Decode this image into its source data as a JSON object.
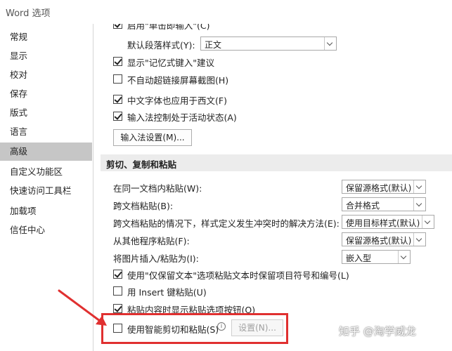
{
  "window": {
    "title": "Word 选项"
  },
  "sidebar": {
    "items": [
      {
        "label": "常规"
      },
      {
        "label": "显示"
      },
      {
        "label": "校对"
      },
      {
        "label": "保存"
      },
      {
        "label": "版式"
      },
      {
        "label": "语言"
      },
      {
        "label": "高级",
        "active": true
      },
      {
        "label": "自定义功能区"
      },
      {
        "label": "快速访问工具栏"
      },
      {
        "label": "加载项"
      },
      {
        "label": "信任中心"
      }
    ]
  },
  "main": {
    "top_cut_label": "启用\"单击即输入\"(C)",
    "default_para_style": {
      "label": "默认段落样式(Y):",
      "value": "正文"
    },
    "options_a": [
      {
        "label": "显示\"记忆式键入\"建议",
        "checked": true
      },
      {
        "label": "不自动超链接屏幕截图(H)",
        "checked": false
      },
      {
        "label": "中文字体也应用于西文(F)",
        "checked": true
      },
      {
        "label": "输入法控制处于活动状态(A)",
        "checked": true
      }
    ],
    "ime_settings_button": "输入法设置(M)...",
    "cut_copy_paste": {
      "section_title": "剪切、复制和粘贴",
      "rows": [
        {
          "label": "在同一文档内粘贴(W):",
          "value": "保留源格式(默认)"
        },
        {
          "label": "跨文档粘贴(B):",
          "value": "合并格式"
        },
        {
          "label": "跨文档粘贴的情况下，样式定义发生冲突时的解决方法(E):",
          "value": "使用目标样式(默认)"
        },
        {
          "label": "从其他程序粘贴(F):",
          "value": "保留源格式(默认)"
        },
        {
          "label": "将图片插入/粘贴为(I):",
          "value": "嵌入型"
        }
      ],
      "options_b": [
        {
          "label": "使用\"仅保留文本\"选项粘贴文本时保留项目符号和编号(L)",
          "checked": true
        },
        {
          "label": "用 Insert 键粘贴(U)",
          "checked": false
        },
        {
          "label": "粘贴内容时显示粘贴选项按钮(O)",
          "checked": true
        },
        {
          "label": "使用智能剪切和粘贴(S)",
          "checked": false
        }
      ],
      "smart_settings_button": "设置(N)..."
    }
  },
  "overlay": {
    "highlight_color": "#e03030",
    "watermark": "知乎 @淘学威龙"
  }
}
